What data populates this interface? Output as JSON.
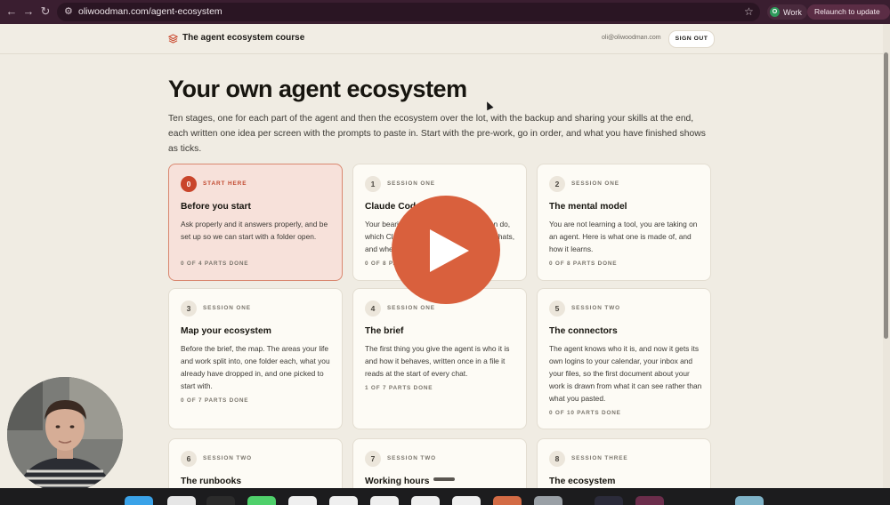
{
  "browser": {
    "url": "oliwoodman.com/agent-ecosystem",
    "profile_initial": "O",
    "profile_label": "Work",
    "relaunch_label": "Relaunch to update"
  },
  "header": {
    "site_title": "The agent ecosystem course",
    "email": "oli@oliwoodman.com",
    "signout_label": "SIGN OUT"
  },
  "hero": {
    "title": "Your own agent ecosystem",
    "description": "Ten stages, one for each part of the agent and then the ecosystem over the lot, with the backup and sharing your skills at the end, each written one idea per screen with the prompts to paste in. Start with the pre-work, go in order, and what you have finished shows as ticks."
  },
  "cards": [
    {
      "num": "0",
      "session": "START HERE",
      "title": "Before you start",
      "desc": "Ask properly and it answers properly, and be set up so we can start with a folder open.",
      "progress": "0 OF 4 PARTS DONE"
    },
    {
      "num": "1",
      "session": "SESSION ONE",
      "title": "Claude Code",
      "desc": "Your bearings. What it is and what it can do, which Claude surfaces you have used, chats, and when.",
      "progress": "0 OF 8 PARTS DONE"
    },
    {
      "num": "2",
      "session": "SESSION ONE",
      "title": "The mental model",
      "desc": "You are not learning a tool, you are taking on an agent. Here is what one is made of, and how it learns.",
      "progress": "0 OF 8 PARTS DONE"
    },
    {
      "num": "3",
      "session": "SESSION ONE",
      "title": "Map your ecosystem",
      "desc": "Before the brief, the map. The areas your life and work split into, one folder each, what you already have dropped in, and one picked to start with.",
      "progress": "0 OF 7 PARTS DONE"
    },
    {
      "num": "4",
      "session": "SESSION ONE",
      "title": "The brief",
      "desc": "The first thing you give the agent is who it is and how it behaves, written once in a file it reads at the start of every chat.",
      "progress": "1 OF 7 PARTS DONE"
    },
    {
      "num": "5",
      "session": "SESSION TWO",
      "title": "The connectors",
      "desc": "The agent knows who it is, and now it gets its own logins to your calendar, your inbox and your files, so the first document about your work is drawn from what it can see rather than what you pasted.",
      "progress": "0 OF 10 PARTS DONE"
    },
    {
      "num": "6",
      "session": "SESSION TWO",
      "title": "The runbooks",
      "desc": "",
      "progress": ""
    },
    {
      "num": "7",
      "session": "SESSION TWO",
      "title": "Working hours",
      "desc": "",
      "progress": ""
    },
    {
      "num": "8",
      "session": "SESSION THREE",
      "title": "The ecosystem",
      "desc": "",
      "progress": ""
    }
  ]
}
